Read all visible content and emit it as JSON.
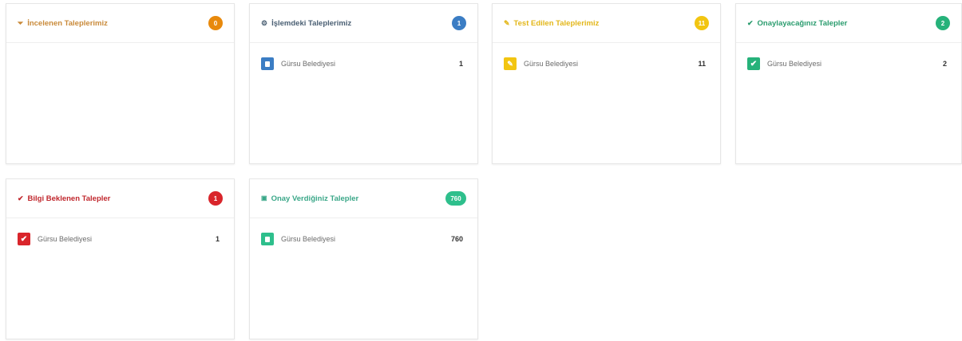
{
  "colors": {
    "orange": "#e8890c",
    "blue": "#3b7dc4",
    "yellow": "#f2c511",
    "green": "#26b27a",
    "red": "#d9252b",
    "teal": "#2ebf8c"
  },
  "cards": [
    {
      "title": "İncelenen Taleplerimiz",
      "icon": "filter-icon",
      "icon_glyph": "⏷",
      "badge": "0",
      "rows": []
    },
    {
      "title": "İşlemdeki Taleplerimiz",
      "icon": "gear-icon",
      "icon_glyph": "⚙",
      "badge": "1",
      "rows": [
        {
          "label": "Gürsu Belediyesi",
          "count": "1"
        }
      ]
    },
    {
      "title": "Test Edilen Taleplerimiz",
      "icon": "edit-icon",
      "icon_glyph": "✎",
      "badge": "11",
      "rows": [
        {
          "label": "Gürsu Belediyesi",
          "count": "11"
        }
      ]
    },
    {
      "title": "Onaylayacağınız Talepler",
      "icon": "check-icon",
      "icon_glyph": "✔",
      "badge": "2",
      "rows": [
        {
          "label": "Gürsu Belediyesi",
          "count": "2"
        }
      ]
    },
    {
      "title": "Bilgi Beklenen Talepler",
      "icon": "check-icon",
      "icon_glyph": "✔",
      "badge": "1",
      "rows": [
        {
          "label": "Gürsu Belediyesi",
          "count": "1"
        }
      ]
    },
    {
      "title": "Onay Verdiğiniz Talepler",
      "icon": "lock-icon",
      "icon_glyph": "🔒",
      "badge": "760",
      "rows": [
        {
          "label": "Gürsu Belediyesi",
          "count": "760"
        }
      ]
    }
  ]
}
